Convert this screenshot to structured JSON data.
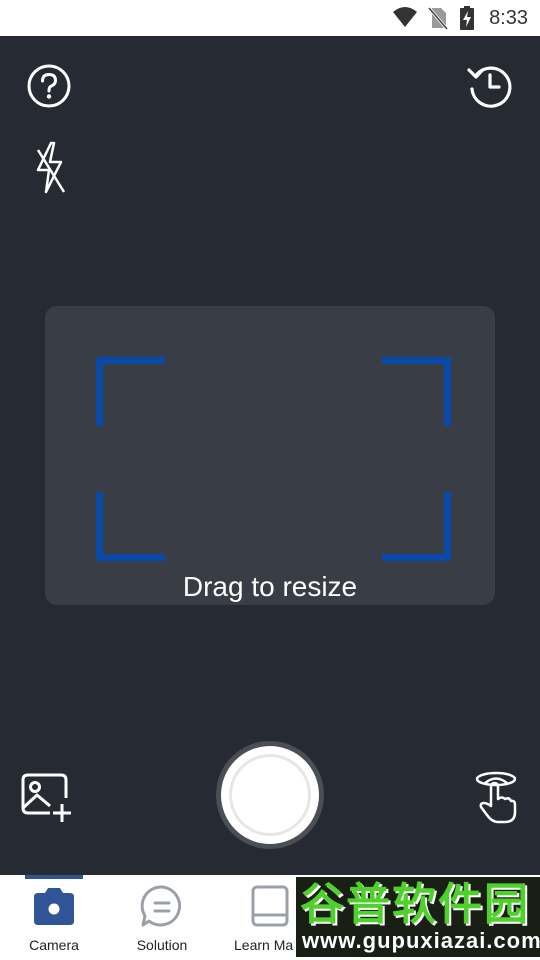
{
  "status_bar": {
    "time": "8:33",
    "icons": [
      "wifi-icon",
      "no-sim-icon",
      "battery-charging-icon"
    ]
  },
  "camera": {
    "top_left_icons": [
      "help-icon",
      "flash-off-icon"
    ],
    "top_right_icons": [
      "history-icon"
    ],
    "crop_hint": "Drag to resize",
    "accent_color": "#0a49a8",
    "bottom_icons": [
      "add-image-icon",
      "shutter-button",
      "tap-gesture-icon"
    ]
  },
  "bottom_nav": {
    "active_color": "#2f5597",
    "items": [
      {
        "label": "Camera",
        "icon": "camera-icon",
        "active": true
      },
      {
        "label": "Solution",
        "icon": "solution-icon",
        "active": false
      },
      {
        "label": "Learn Ma",
        "icon": "book-icon",
        "active": false
      }
    ]
  },
  "watermark": {
    "chinese": "谷普软件园",
    "url": "www.gupuxiazai.com"
  }
}
